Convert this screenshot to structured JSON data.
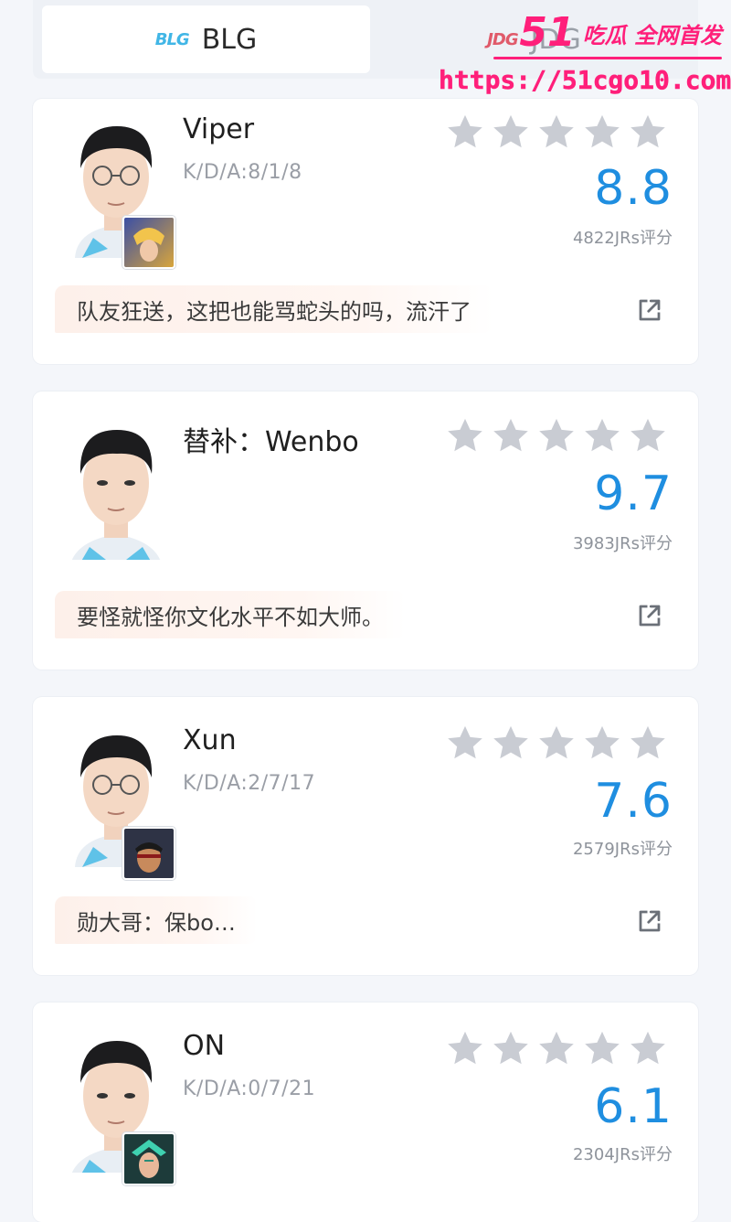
{
  "tabs": [
    {
      "logo": "BLG",
      "label": "BLG",
      "active": true
    },
    {
      "logo": "JDG",
      "label": "JDG",
      "active": false
    }
  ],
  "watermark": {
    "number": "51",
    "tagline": "吃瓜 全网首发",
    "url": "https://51cgo10.com"
  },
  "players": [
    {
      "name": "Viper",
      "kda": "K/D/A:8/1/8",
      "score": "8.8",
      "votes": "4822JRs评分",
      "comment": "队友狂送，这把也能骂蛇头的吗，流汗了",
      "hero": "ezreal",
      "stars": 5
    },
    {
      "name": "替补：Wenbo",
      "kda": "",
      "score": "9.7",
      "votes": "3983JRs评分",
      "comment": "要怪就怪你文化水平不如大师。",
      "hero": "",
      "stars": 5
    },
    {
      "name": "Xun",
      "kda": "K/D/A:2/7/17",
      "score": "7.6",
      "votes": "2579JRs评分",
      "comment": "勋大哥：保bo…",
      "hero": "lee-sin",
      "stars": 5
    },
    {
      "name": "ON",
      "kda": "K/D/A:0/7/21",
      "score": "6.1",
      "votes": "2304JRs评分",
      "comment": "",
      "hero": "karma",
      "stars": 5
    }
  ],
  "colors": {
    "accent": "#1f8ee0",
    "star": "#c9ccd3",
    "bubble": "#fdf0ea",
    "watermark": "#ff1f7a"
  },
  "icons": {
    "star": "star-icon",
    "share": "share-icon",
    "avatar": "avatar"
  }
}
